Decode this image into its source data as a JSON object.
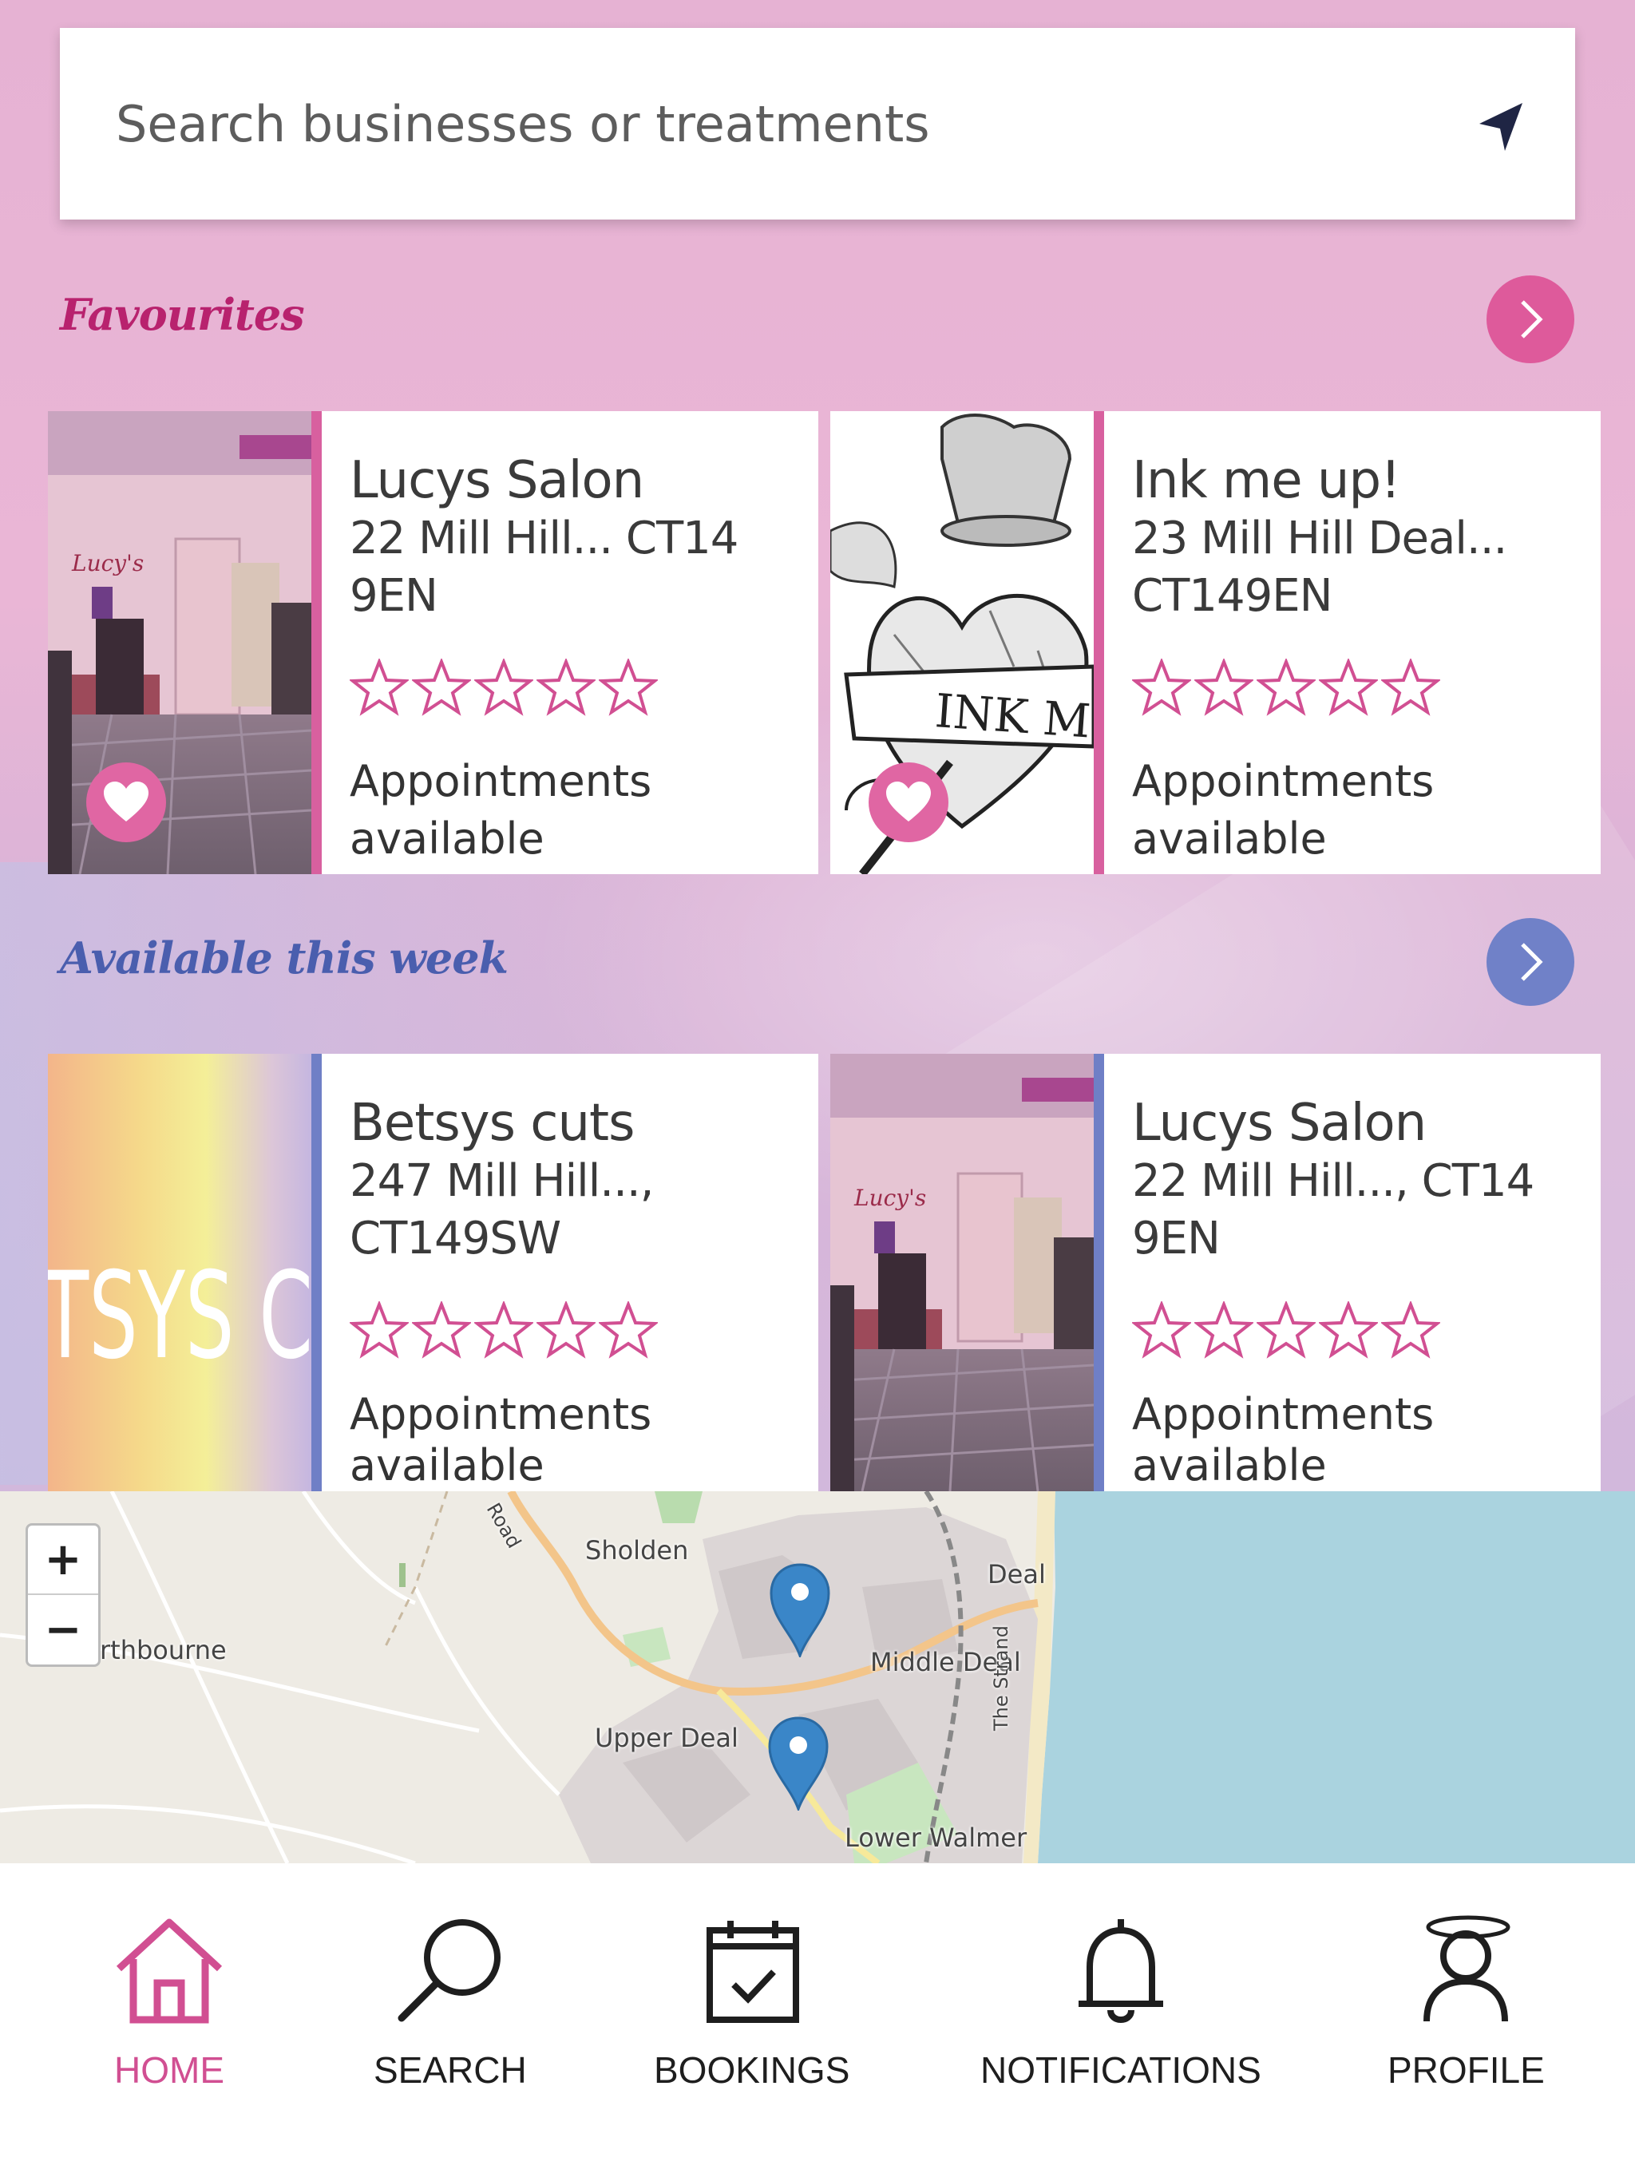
{
  "search": {
    "placeholder": "Search businesses or treatments"
  },
  "favourites": {
    "title": "Favourites",
    "cards": [
      {
        "name": "Lucys Salon",
        "address": "22 Mill Hill... CT14 9EN",
        "rating": 0,
        "max_rating": 5,
        "availability": "Appointments available"
      },
      {
        "name": "Ink me up!",
        "address": "23 Mill Hill Deal... CT149EN",
        "rating": 0,
        "max_rating": 5,
        "availability": "Appointments available"
      }
    ]
  },
  "available": {
    "title": "Available this week",
    "cards": [
      {
        "name": "Betsys cuts",
        "address": "247 Mill Hill..., CT149SW",
        "rating": 0,
        "max_rating": 5,
        "availability": "Appointments available"
      },
      {
        "name": "Lucys Salon",
        "address": "22 Mill Hill..., CT14 9EN",
        "rating": 0,
        "max_rating": 5,
        "availability": "Appointments available"
      }
    ]
  },
  "thumbnails": {
    "lucys_sign": "Lucy's",
    "ink_banner": "INK ME UP",
    "betsys_text": "TSYS C"
  },
  "map": {
    "zoom_in": "+",
    "zoom_out": "−",
    "labels": {
      "sholden": "Sholden",
      "deal": "Deal",
      "northbourne": "rthbourne",
      "middle_deal": "Middle Deal",
      "upper_deal": "Upper Deal",
      "lower_walmer": "Lower Walmer",
      "the_strand": "The Strand",
      "road": "Road"
    }
  },
  "nav": {
    "items": [
      {
        "label": "HOME",
        "icon": "home-icon",
        "active": true
      },
      {
        "label": "SEARCH",
        "icon": "search-icon",
        "active": false
      },
      {
        "label": "BOOKINGS",
        "icon": "calendar-icon",
        "active": false
      },
      {
        "label": "NOTIFICATIONS",
        "icon": "bell-icon",
        "active": false
      },
      {
        "label": "PROFILE",
        "icon": "profile-icon",
        "active": false
      }
    ]
  },
  "colors": {
    "pink_accent": "#de5a9b",
    "blue_accent": "#7081c8",
    "favourites_title": "#b8226e",
    "available_title": "#4a5eae",
    "star_outline": "#d14f92",
    "sea": "#aad3df"
  }
}
